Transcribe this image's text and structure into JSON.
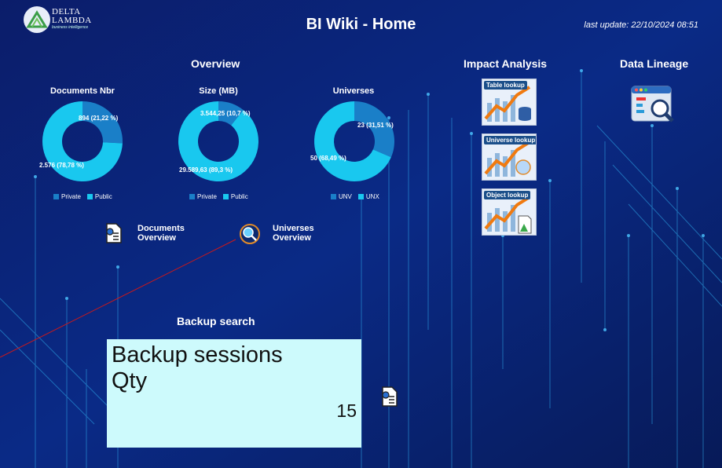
{
  "logo": {
    "line1": "DELTA",
    "line2": "LAMBDA",
    "sub": "business intelligence"
  },
  "header": {
    "title": "BI Wiki - Home",
    "last_update": "last update: 22/10/2024 08:51"
  },
  "overview": {
    "title": "Overview",
    "charts": [
      {
        "title": "Documents Nbr",
        "slices": [
          {
            "name": "Private",
            "value": 894,
            "label": "894 (21,22 %)",
            "pct": 21.22,
            "color": "#1a7fc8"
          },
          {
            "name": "Public",
            "value": 2576,
            "label": "2.576 (78,78 %)",
            "pct": 78.78,
            "color": "#19c8ef"
          }
        ]
      },
      {
        "title": "Size (MB)",
        "slices": [
          {
            "name": "Private",
            "value": 3544.25,
            "label": "3.544,25 (10,7 %)",
            "pct": 10.7,
            "color": "#1a7fc8"
          },
          {
            "name": "Public",
            "value": 29589.63,
            "label": "29.589,63 (89,3 %)",
            "pct": 89.3,
            "color": "#19c8ef"
          }
        ]
      },
      {
        "title": "Universes",
        "slices": [
          {
            "name": "UNV",
            "value": 23,
            "label": "23 (31,51 %)",
            "pct": 31.51,
            "color": "#1a7fc8"
          },
          {
            "name": "UNX",
            "value": 50,
            "label": "50 (68,49 %)",
            "pct": 68.49,
            "color": "#19c8ef"
          }
        ]
      }
    ],
    "links": [
      {
        "label_line1": "Documents",
        "label_line2": "Overview"
      },
      {
        "label_line1": "Universes",
        "label_line2": "Overview"
      }
    ]
  },
  "chart_data": [
    {
      "type": "pie",
      "title": "Documents Nbr",
      "categories": [
        "Private",
        "Public"
      ],
      "values": [
        894,
        2576
      ],
      "legend": "bottom"
    },
    {
      "type": "pie",
      "title": "Size (MB)",
      "categories": [
        "Private",
        "Public"
      ],
      "values": [
        3544.25,
        29589.63
      ],
      "legend": "bottom"
    },
    {
      "type": "pie",
      "title": "Universes",
      "categories": [
        "UNV",
        "UNX"
      ],
      "values": [
        23,
        50
      ],
      "legend": "bottom"
    }
  ],
  "impact": {
    "title": "Impact Analysis",
    "tiles": [
      "Table lookup",
      "Universe lookup",
      "Object lookup"
    ]
  },
  "lineage": {
    "title": "Data Lineage"
  },
  "backup": {
    "title": "Backup search",
    "box_line1": "Backup sessions",
    "box_line2": "Qty",
    "value": "15"
  },
  "colors": {
    "private": "#1a7fc8",
    "public": "#19c8ef",
    "box": "#cdfafc",
    "background": "#0a1a5e"
  }
}
